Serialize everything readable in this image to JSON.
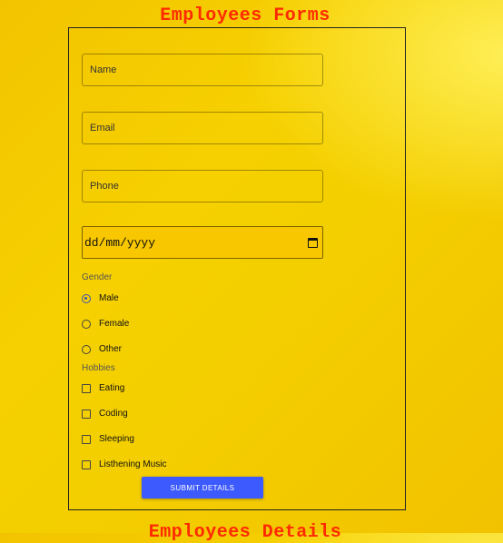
{
  "header": {
    "title": "Employees Forms"
  },
  "form": {
    "name_placeholder": "Name",
    "email_placeholder": "Email",
    "phone_placeholder": "Phone",
    "date_value": "dd/mm/yyyy",
    "gender_label": "Gender",
    "gender_options": [
      {
        "label": "Male",
        "selected": true
      },
      {
        "label": "Female",
        "selected": false
      },
      {
        "label": "Other",
        "selected": false
      }
    ],
    "hobbies_label": "Hobbies",
    "hobby_options": [
      {
        "label": "Eating",
        "checked": false
      },
      {
        "label": "Coding",
        "checked": false
      },
      {
        "label": "Sleeping",
        "checked": false
      },
      {
        "label": "Listhening Music",
        "checked": false
      }
    ],
    "submit_label": "SUBMIT DETAILS"
  },
  "next_section": {
    "title": "Employees Details"
  },
  "colors": {
    "accent": "#3d5afe",
    "title": "#ff2a00",
    "background": "#f4cf00"
  }
}
